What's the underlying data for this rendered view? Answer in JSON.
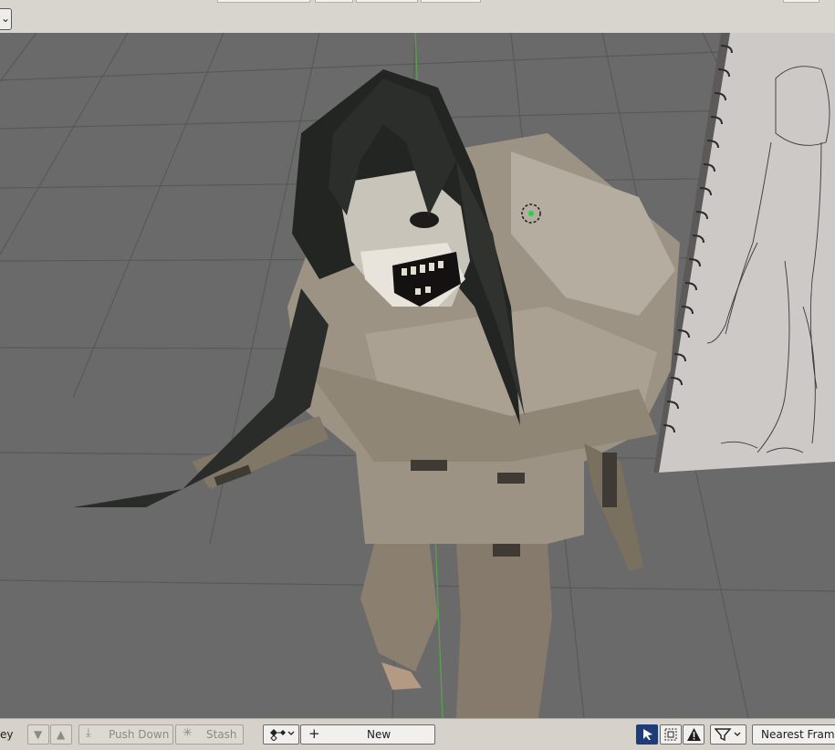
{
  "topbar": {
    "dropdown_icon": "chevron-down-icon"
  },
  "viewport": {
    "subject": "3d-character-model",
    "reference": "sketchbook-drawing"
  },
  "bottombar": {
    "mode_text": "ey",
    "move_down_icon": "triangle-down-icon",
    "move_up_icon": "triangle-up-icon",
    "push_down_label": "Push Down",
    "stash_label": "Stash",
    "action_icon": "keyframe-action-icon",
    "new_label": "New",
    "snapping_label": "Nearest Frame",
    "icons": [
      "cursor-select-icon",
      "box-select-icon",
      "warning-icon",
      "filter-icon"
    ],
    "colors": {
      "select_active": "#1f3c78",
      "new_button": "#f2f0ed"
    }
  }
}
